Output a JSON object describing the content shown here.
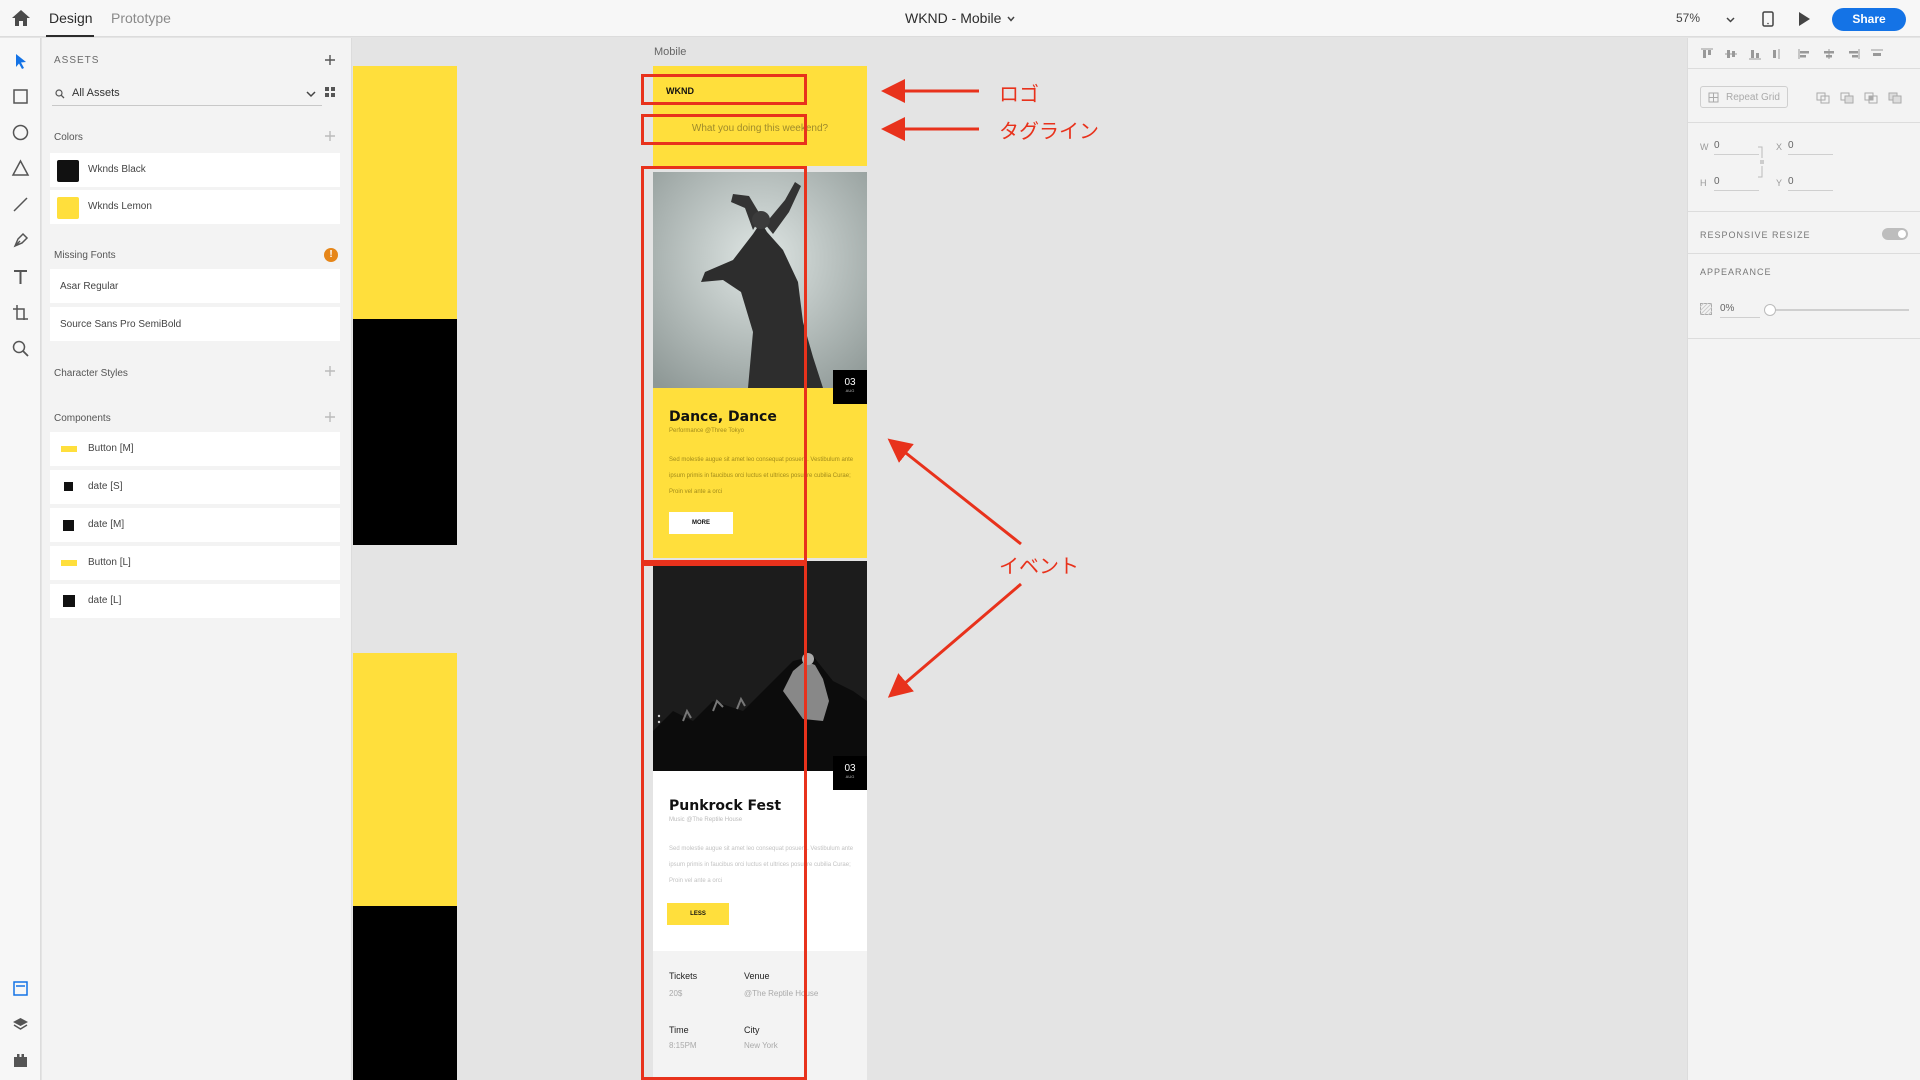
{
  "topbar": {
    "tabs": [
      "Design",
      "Prototype"
    ],
    "document_title": "WKND - Mobile",
    "zoom": "57%",
    "share_label": "Share"
  },
  "assets": {
    "title": "ASSETS",
    "filter": "All Assets",
    "colors_label": "Colors",
    "colors": [
      {
        "name": "Wknds Black",
        "hex": "#111111"
      },
      {
        "name": "Wknds Lemon",
        "hex": "#ffdf3c"
      }
    ],
    "missing_fonts_label": "Missing Fonts",
    "missing_fonts_badge": "!",
    "fonts": [
      "Asar Regular",
      "Source Sans Pro SemiBold"
    ],
    "character_styles_label": "Character Styles",
    "components_label": "Components",
    "components": [
      "Button [M]",
      "date [S]",
      "date [M]",
      "Button [L]",
      "date [L]"
    ]
  },
  "canvas": {
    "artboard_label": "Mobile",
    "logo": "WKND",
    "tagline": "What you doing this weekend?",
    "events": [
      {
        "title": "Dance, Dance",
        "subtitle": "Performance @Three Tokyo",
        "day": "03",
        "month": "AUG",
        "body": "Sed molestie augue sit amet leo consequat posuere. Vestibulum ante ipsum primis in faucibus orci luctus et ultrices posuere cubilia Curae; Proin vel ante a orci",
        "button": "MORE"
      },
      {
        "title": "Punkrock Fest",
        "subtitle": "Music @The Reptile House",
        "day": "03",
        "month": "AUG",
        "body": "Sed molestie augue sit amet leo consequat posuere. Vestibulum ante ipsum primis in faucibus orci luctus et ultrices posuere cubilia Curae; Proin vel ante a orci",
        "button": "LESS",
        "details": [
          {
            "label": "Tickets",
            "value": "20$"
          },
          {
            "label": "Venue",
            "value": "@The Reptile House"
          },
          {
            "label": "Time",
            "value": "8:15PM"
          },
          {
            "label": "City",
            "value": "New York"
          }
        ]
      }
    ],
    "annotations": {
      "logo": "ロゴ",
      "tagline": "タグライン",
      "events": "イベント"
    },
    "accent": "#ffdf3c",
    "annotation_color": "#e8321c"
  },
  "properties": {
    "repeat_grid": "Repeat Grid",
    "w_label": "W",
    "w": "0",
    "x_label": "X",
    "x": "0",
    "h_label": "H",
    "h": "0",
    "y_label": "Y",
    "y": "0",
    "responsive_resize": "RESPONSIVE RESIZE",
    "appearance": "APPEARANCE",
    "opacity": "0%"
  }
}
